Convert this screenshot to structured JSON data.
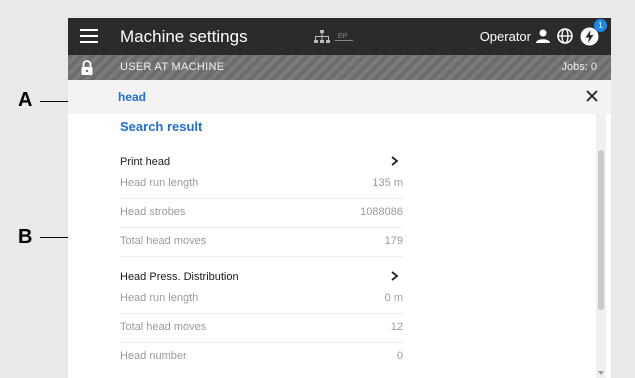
{
  "annotations": {
    "a": "A",
    "b": "B"
  },
  "header": {
    "title": "Machine settings",
    "network_label": "EP",
    "operator": "Operator",
    "notification_count": "1"
  },
  "userbar": {
    "label": "USER AT MACHINE",
    "jobs": "Jobs: 0"
  },
  "search": {
    "value": "head"
  },
  "results": {
    "title": "Search result",
    "groups": [
      {
        "name": "Print head",
        "items": [
          {
            "label": "Head run length",
            "value": "135 m"
          },
          {
            "label": "Head strobes",
            "value": "1088086"
          },
          {
            "label": "Total head moves",
            "value": "179"
          }
        ]
      },
      {
        "name": "Head Press. Distribution",
        "items": [
          {
            "label": "Head run length",
            "value": "0 m"
          },
          {
            "label": "Total head moves",
            "value": "12"
          },
          {
            "label": "Head number",
            "value": "0"
          }
        ]
      }
    ]
  },
  "icons": {
    "menu": "hamburger-icon",
    "network": "network-icon",
    "user": "user-icon",
    "globe": "globe-icon",
    "bolt": "power-bolt-icon",
    "lock": "lock-icon",
    "clear": "close-icon",
    "chevron": "chevron-right-icon"
  },
  "colors": {
    "accent": "#1e6fd0",
    "topbar": "#2b2b2b",
    "badge": "#1e88e5"
  }
}
